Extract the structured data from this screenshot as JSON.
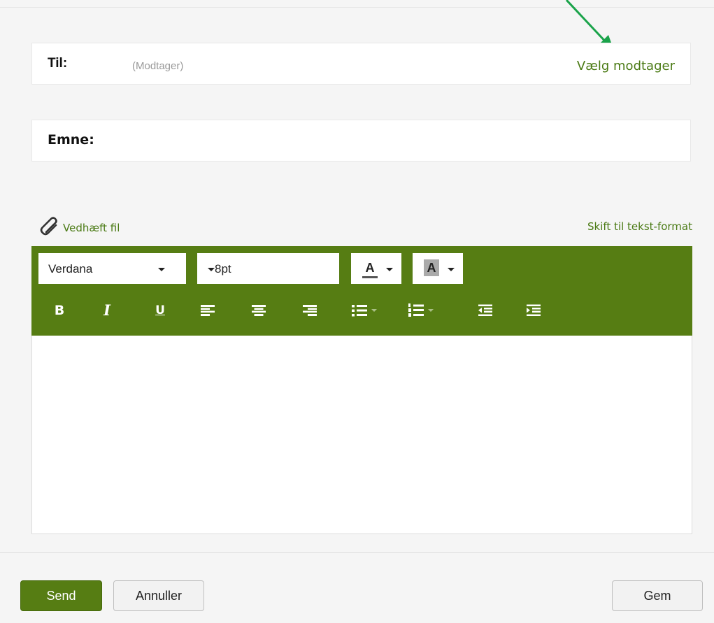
{
  "to": {
    "label": "Til:",
    "placeholder": "(Modtager)",
    "choose_recipient": "Vælg modtager"
  },
  "subject": {
    "label": "Emne:"
  },
  "attach": {
    "label": "Vedhæft fil",
    "icon": "paperclip-icon"
  },
  "switch_format": "Skift til tekst-format",
  "toolbar": {
    "font_family": "Verdana",
    "font_size": "8pt",
    "font_color_glyph": "A",
    "bg_color_glyph": "A",
    "bold_glyph": "B",
    "italic_glyph": "I",
    "underline_glyph": "U"
  },
  "actions": {
    "send": "Send",
    "cancel": "Annuller",
    "save": "Gem"
  },
  "colors": {
    "accent": "#567d13",
    "link": "#4a7a14",
    "annotation_arrow": "#1aa34a"
  }
}
